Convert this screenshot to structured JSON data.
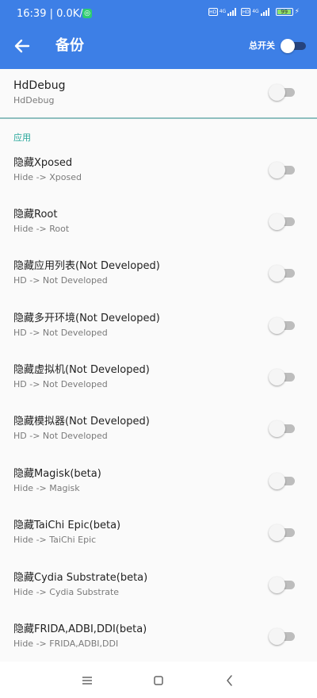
{
  "status_bar": {
    "time_speed": "16:39 | 0.0K/s",
    "hd_badge": "HD",
    "signal_label": "4G",
    "battery": "99",
    "battery_level": 99
  },
  "header": {
    "title": "备份",
    "master_switch_label": "总开关",
    "master_switch_on": true,
    "back_icon": "arrow-left-icon",
    "accent_color": "#3d7fe6"
  },
  "debug_item": {
    "title": "HdDebug",
    "subtitle": "HdDebug",
    "enabled": false
  },
  "section": {
    "title": "应用",
    "color": "#26a69a"
  },
  "items": [
    {
      "title": "隐藏Xposed",
      "subtitle": "Hide -> Xposed",
      "enabled": false
    },
    {
      "title": "隐藏Root",
      "subtitle": "Hide -> Root",
      "enabled": false
    },
    {
      "title": "隐藏应用列表(Not Developed)",
      "subtitle": "HD -> Not Developed",
      "enabled": false
    },
    {
      "title": "隐藏多开环境(Not Developed)",
      "subtitle": "HD -> Not Developed",
      "enabled": false
    },
    {
      "title": "隐藏虚拟机(Not Developed)",
      "subtitle": "HD -> Not Developed",
      "enabled": false
    },
    {
      "title": "隐藏模拟器(Not Developed)",
      "subtitle": "HD -> Not Developed",
      "enabled": false
    },
    {
      "title": "隐藏Magisk(beta)",
      "subtitle": "Hide -> Magisk",
      "enabled": false
    },
    {
      "title": "隐藏TaiChi Epic(beta)",
      "subtitle": "Hide -> TaiChi Epic",
      "enabled": false
    },
    {
      "title": "隐藏Cydia Substrate(beta)",
      "subtitle": "Hide -> Cydia Substrate",
      "enabled": false
    },
    {
      "title": "隐藏FRIDA,ADBI,DDI(beta)",
      "subtitle": "Hide -> FRIDA,ADBI,DDI",
      "enabled": false
    }
  ],
  "nav_bar": {
    "menu_icon": "menu-icon",
    "home_icon": "home-icon",
    "back_icon": "back-chevron-icon"
  }
}
